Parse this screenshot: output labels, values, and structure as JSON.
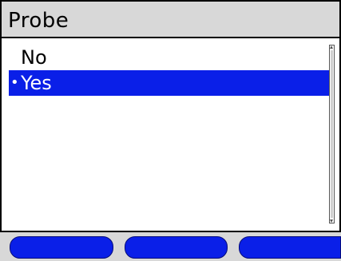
{
  "title": "Probe",
  "options": [
    {
      "label": "No",
      "selected": false
    },
    {
      "label": "Yes",
      "selected": true
    }
  ],
  "selection_marker": "•",
  "colors": {
    "highlight": "#0a1fe8",
    "title_bar": "#d8d8d8",
    "softkey": "#0a1fe8"
  },
  "softkeys": {
    "left_label": "",
    "center_label": "",
    "right_label": ""
  }
}
